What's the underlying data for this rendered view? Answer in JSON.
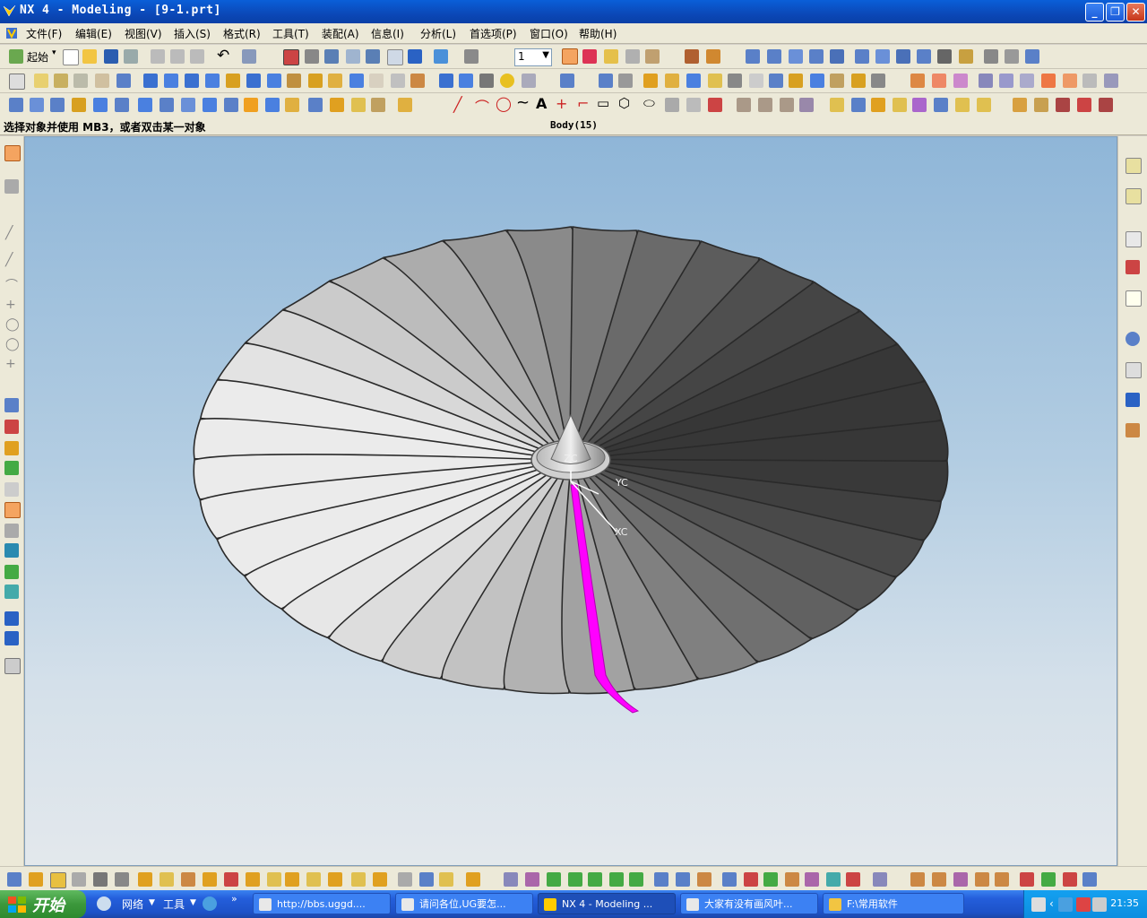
{
  "window": {
    "title": "NX 4 - Modeling - [9-1.prt]"
  },
  "menu": [
    "文件(F)",
    "编辑(E)",
    "视图(V)",
    "插入(S)",
    "格式(R)",
    "工具(T)",
    "装配(A)",
    "信息(I)",
    "分析(L)",
    "首选项(P)",
    "窗口(O)",
    "帮助(H)"
  ],
  "toolbar": {
    "start_label": "起始",
    "layer_value": "1"
  },
  "cue": {
    "prompt": "选择对象并使用 MB3，或者双击某一对象",
    "status": "Body(15)"
  },
  "viewport": {
    "axis_z": "ZC",
    "axis_y": "YC",
    "axis_x": "XC"
  },
  "model": {
    "blade_count": 36,
    "selected_blade_color": "#ff00ff",
    "blade_color": "#9a9a9a",
    "background_top": "#8fb6d8",
    "background_bottom": "#e3e8ec"
  },
  "taskbar": {
    "start_label": "开始",
    "quicklaunch": [
      "网络",
      "工具"
    ],
    "tasks": [
      {
        "label": "http://bbs.uggd...."
      },
      {
        "label": "请问各位,UG要怎..."
      },
      {
        "label": "NX 4 - Modeling ..."
      },
      {
        "label": "大家有没有画风叶..."
      },
      {
        "label": "F:\\常用软件"
      }
    ],
    "clock": "21:35"
  }
}
